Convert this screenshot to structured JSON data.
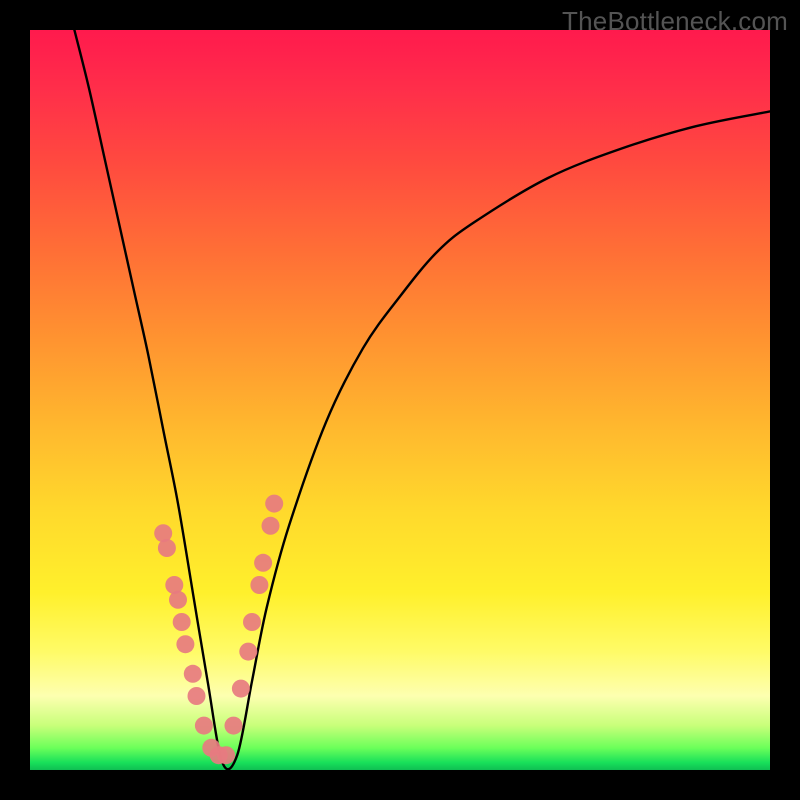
{
  "watermark": "TheBottleneck.com",
  "chart_data": {
    "type": "line",
    "title": "",
    "xlabel": "",
    "ylabel": "",
    "xlim": [
      0,
      100
    ],
    "ylim": [
      0,
      100
    ],
    "background_gradient": {
      "top": "#ff1a4d",
      "bottom": "#0fbf53",
      "meaning": "red = bad / bottleneck, green = optimal"
    },
    "curve_min_x": 26,
    "series": [
      {
        "name": "bottleneck-curve",
        "x": [
          6,
          8,
          10,
          12,
          14,
          16,
          18,
          20,
          22,
          24,
          26,
          28,
          30,
          32,
          35,
          40,
          45,
          50,
          55,
          60,
          70,
          80,
          90,
          100
        ],
        "y": [
          100,
          92,
          83,
          74,
          65,
          56,
          46,
          36,
          24,
          12,
          1,
          2,
          12,
          22,
          33,
          47,
          57,
          64,
          70,
          74,
          80,
          84,
          87,
          89
        ]
      }
    ],
    "markers": {
      "name": "highlighted-points",
      "color": "#e77b80",
      "x": [
        18.0,
        18.5,
        19.5,
        20.0,
        20.5,
        21.0,
        22.0,
        22.5,
        23.5,
        24.5,
        25.5,
        26.5,
        27.5,
        28.5,
        29.5,
        30.0,
        31.0,
        31.5,
        32.5,
        33.0
      ],
      "y": [
        32.0,
        30.0,
        25.0,
        23.0,
        20.0,
        17.0,
        13.0,
        10.0,
        6.0,
        3.0,
        2.0,
        2.0,
        6.0,
        11.0,
        16.0,
        20.0,
        25.0,
        28.0,
        33.0,
        36.0
      ]
    }
  }
}
